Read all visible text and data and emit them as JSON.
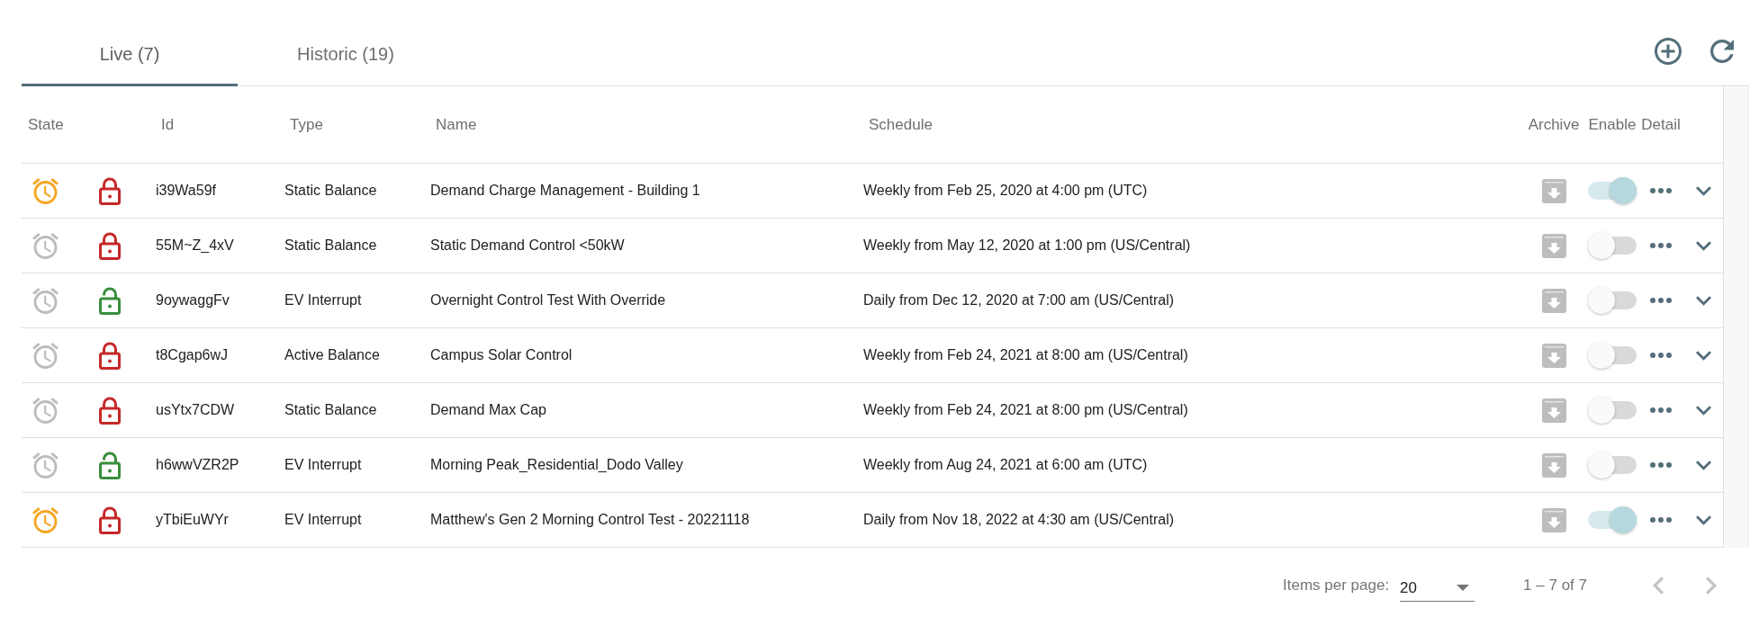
{
  "tabs": [
    {
      "label": "Live (7)",
      "selected": true
    },
    {
      "label": "Historic (19)",
      "selected": false
    }
  ],
  "table": {
    "columns": [
      "State",
      "Id",
      "Type",
      "Name",
      "Schedule",
      "Archive",
      "Enable",
      "Detail"
    ],
    "rows": [
      {
        "active": true,
        "locked": true,
        "id": "i39Wa59f",
        "type": "Static Balance",
        "name": "Demand Charge Management - Building 1",
        "schedule": "Weekly from Feb 25, 2020 at 4:00 pm (UTC)",
        "enabled": true
      },
      {
        "active": false,
        "locked": true,
        "id": "55M~Z_4xV",
        "type": "Static Balance",
        "name": "Static Demand Control <50kW",
        "schedule": "Weekly from May 12, 2020 at 1:00 pm (US/Central)",
        "enabled": false
      },
      {
        "active": false,
        "locked": false,
        "id": "9oywaggFv",
        "type": "EV Interrupt",
        "name": "Overnight Control Test With Override",
        "schedule": "Daily from Dec 12, 2020 at 7:00 am (US/Central)",
        "enabled": false
      },
      {
        "active": false,
        "locked": true,
        "id": "t8Cgap6wJ",
        "type": "Active Balance",
        "name": "Campus Solar Control",
        "schedule": "Weekly from Feb 24, 2021 at 8:00 am (US/Central)",
        "enabled": false
      },
      {
        "active": false,
        "locked": true,
        "id": "usYtx7CDW",
        "type": "Static Balance",
        "name": "Demand Max Cap",
        "schedule": "Weekly from Feb 24, 2021 at 8:00 pm (US/Central)",
        "enabled": false
      },
      {
        "active": false,
        "locked": false,
        "id": "h6wwVZR2P",
        "type": "EV Interrupt",
        "name": "Morning Peak_Residential_Dodo Valley",
        "schedule": "Weekly from Aug 24, 2021 at 6:00 am (UTC)",
        "enabled": false
      },
      {
        "active": true,
        "locked": true,
        "id": "yTbiEuWYr",
        "type": "EV Interrupt",
        "name": "Matthew's Gen 2 Morning Control Test - 20221118",
        "schedule": "Daily from Nov 18, 2022 at 4:30 am (US/Central)",
        "enabled": true
      }
    ]
  },
  "paginator": {
    "label": "Items per page:",
    "page_size": "20",
    "range": "1 – 7 of 7",
    "previous_disabled": true,
    "next_disabled": true
  }
}
